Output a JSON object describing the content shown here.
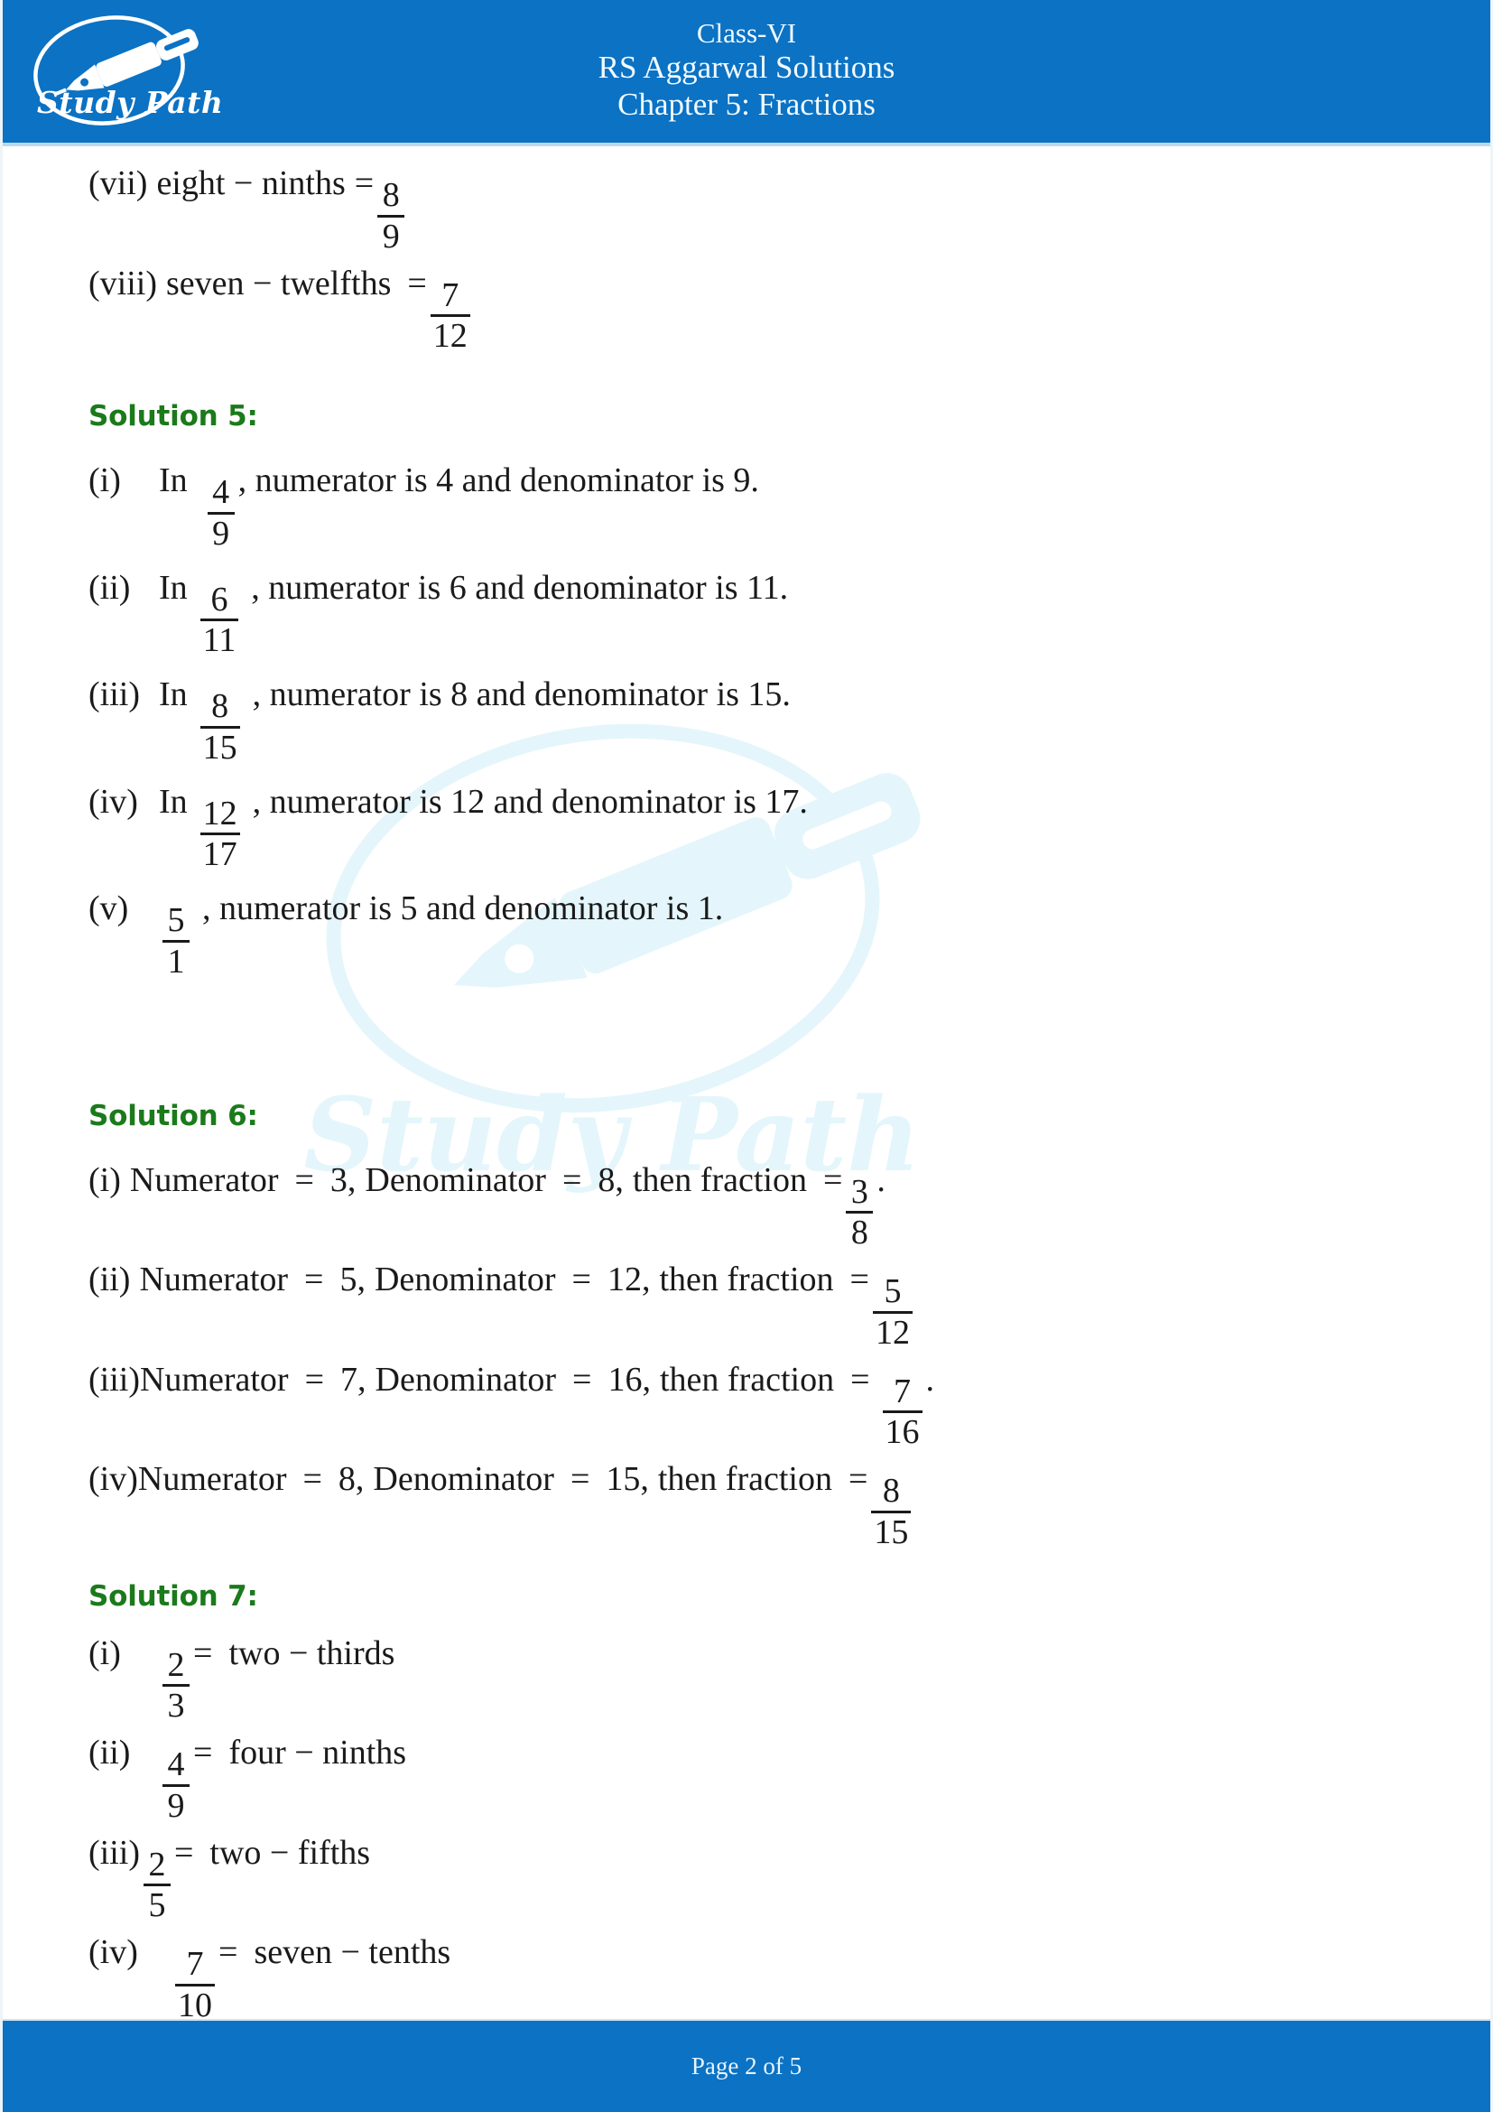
{
  "header": {
    "logo_word": "Study Path",
    "logo_icon": "fountain-pen-in-oval-logo",
    "class_line": "Class-VI",
    "book_line": "RS Aggarwal Solutions",
    "chapter_line": "Chapter 5: Fractions",
    "bg_color": "#0b72c4"
  },
  "watermark": {
    "word": "Study Path",
    "icon": "fountain-pen-in-oval-watermark",
    "color": "#e4f6fb"
  },
  "top_items": [
    {
      "label": "(vii)",
      "text": "eight − ninths",
      "eq": "=",
      "num": "8",
      "den": "9"
    },
    {
      "label": "(viii)",
      "text": "seven − twelfths",
      "eq": "=",
      "num": "7",
      "den": "12"
    }
  ],
  "solution5": {
    "heading": "Solution 5:",
    "heading_color": "#1b7a1b",
    "items": [
      {
        "label": "(i)",
        "prefix": "In",
        "num": "4",
        "den": "9",
        "tail": ", numerator is 4 and denominator is 9."
      },
      {
        "label": "(ii)",
        "prefix": "In",
        "num": "6",
        "den": "11",
        "tail": ", numerator is 6 and denominator is 11."
      },
      {
        "label": "(iii)",
        "prefix": "In",
        "num": "8",
        "den": "15",
        "tail": ", numerator is 8 and denominator is 15."
      },
      {
        "label": "(iv)",
        "prefix": "In",
        "num": "12",
        "den": "17",
        "tail": ", numerator is 12 and denominator is 17."
      },
      {
        "label": "(v)",
        "prefix": "",
        "num": "5",
        "den": "1",
        "tail": ", numerator is 5 and denominator is 1."
      }
    ]
  },
  "solution6": {
    "heading": "Solution 6:",
    "heading_color": "#1b7a1b",
    "items": [
      {
        "label": "(i)",
        "numerator_word": "Numerator",
        "eq1": "=",
        "numerator_value": "3,",
        "denominator_word": "Denominator",
        "eq2": "=",
        "denominator_value": "8,",
        "then": "then fraction",
        "eq3": "=",
        "num": "3",
        "den": "8",
        "period": "."
      },
      {
        "label": "(ii)",
        "numerator_word": "Numerator",
        "eq1": "=",
        "numerator_value": "5,",
        "denominator_word": "Denominator",
        "eq2": "=",
        "denominator_value": "12,",
        "then": "then fraction",
        "eq3": "=",
        "num": "5",
        "den": "12",
        "period": ""
      },
      {
        "label": "(iii)",
        "numerator_word": "Numerator",
        "eq1": "=",
        "numerator_value": "7,",
        "denominator_word": "Denominator",
        "eq2": "=",
        "denominator_value": "16,",
        "then": "then fraction",
        "eq3": "=",
        "num": "7",
        "den": "16",
        "period": "."
      },
      {
        "label": "(iv)",
        "numerator_word": "Numerator",
        "eq1": "=",
        "numerator_value": "8,",
        "denominator_word": "Denominator",
        "eq2": "=",
        "denominator_value": "15,",
        "then": "then fraction",
        "eq3": "=",
        "num": "8",
        "den": "15",
        "period": ""
      }
    ]
  },
  "solution7": {
    "heading": "Solution 7:",
    "heading_color": "#1b7a1b",
    "items": [
      {
        "label": "(i)",
        "num": "2",
        "den": "3",
        "eq": "=",
        "text": "two − thirds"
      },
      {
        "label": "(ii)",
        "num": "4",
        "den": "9",
        "eq": "=",
        "text": "four − ninths"
      },
      {
        "label": "(iii)",
        "num": "2",
        "den": "5",
        "eq": "=",
        "text": "two − fifths"
      },
      {
        "label": "(iv)",
        "num": "7",
        "den": "10",
        "eq": "=",
        "text": "seven − tenths"
      }
    ]
  },
  "footer": {
    "text": "Page 2 of 5",
    "bg_color": "#0b72c4"
  }
}
